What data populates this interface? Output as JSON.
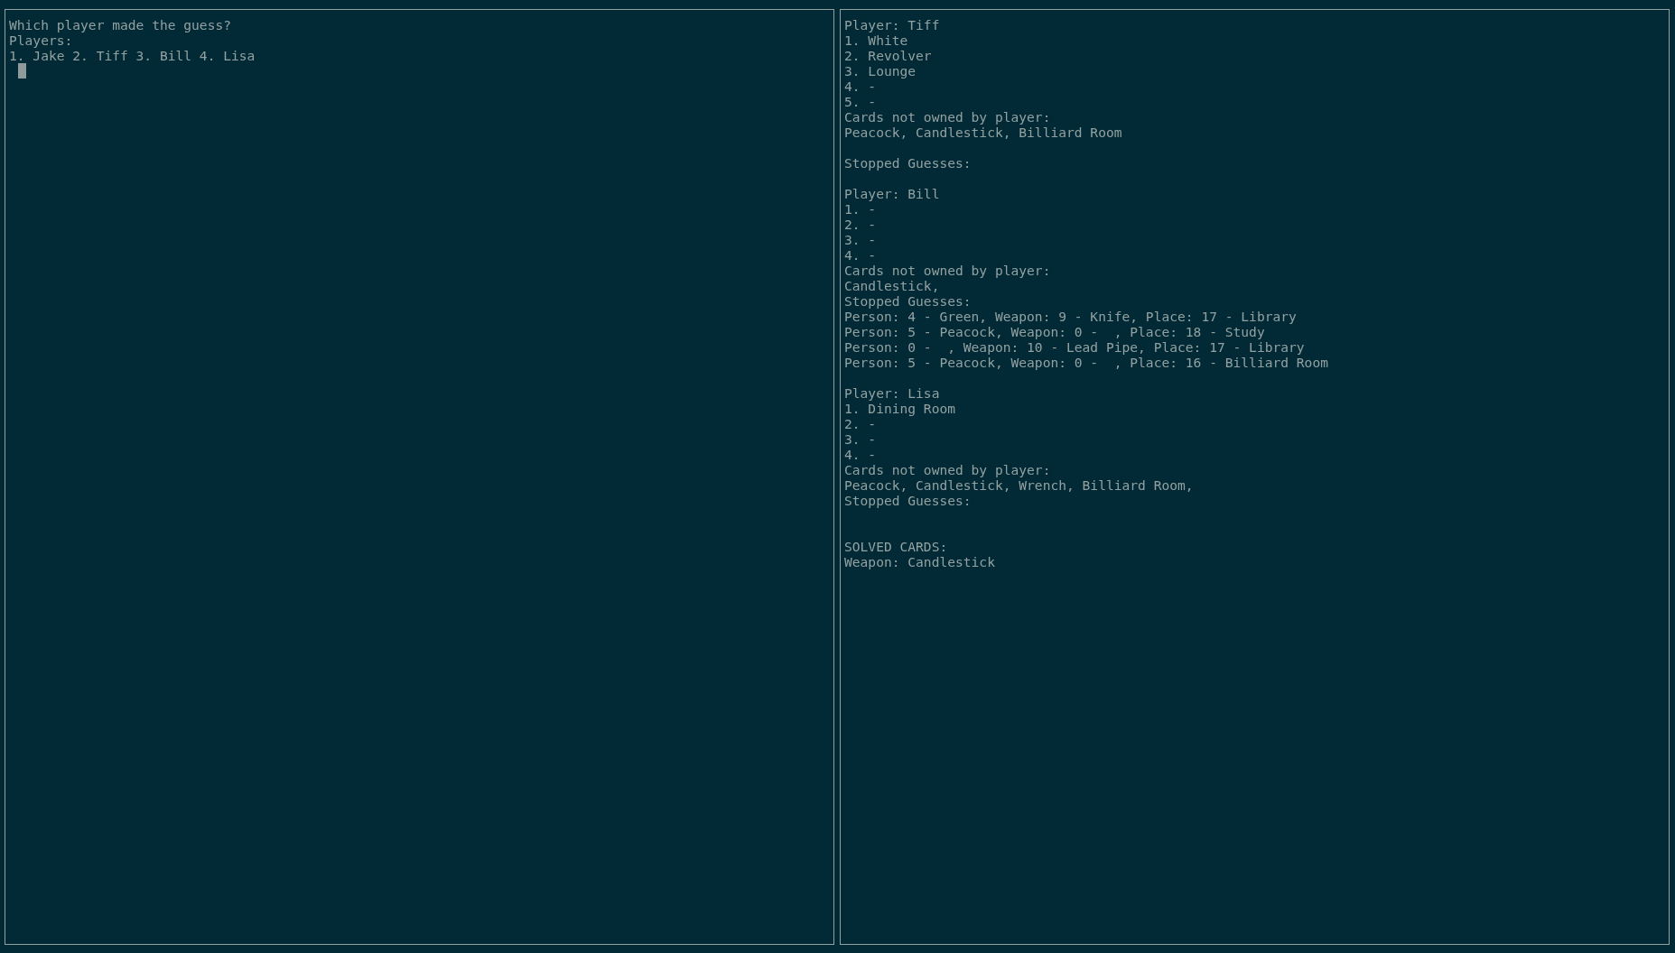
{
  "panes": [
    {
      "lines": [
        {
          "kind": "text",
          "text": "Which player made the guess?"
        },
        {
          "kind": "text",
          "text": "Players:"
        },
        {
          "kind": "text",
          "text": "1. Jake 2. Tiff 3. Bill 4. Lisa"
        },
        {
          "kind": "cursor"
        }
      ]
    },
    {
      "lines": [
        {
          "kind": "text",
          "text": "Player: Tiff"
        },
        {
          "kind": "text",
          "text": "1. White"
        },
        {
          "kind": "text",
          "text": "2. Revolver"
        },
        {
          "kind": "text",
          "text": "3. Lounge"
        },
        {
          "kind": "text",
          "text": "4. -"
        },
        {
          "kind": "text",
          "text": "5. -"
        },
        {
          "kind": "text",
          "text": "Cards not owned by player:"
        },
        {
          "kind": "text",
          "text": "Peacock, Candlestick, Billiard Room"
        },
        {
          "kind": "blank"
        },
        {
          "kind": "text",
          "text": "Stopped Guesses:"
        },
        {
          "kind": "blank"
        },
        {
          "kind": "text",
          "text": "Player: Bill"
        },
        {
          "kind": "text",
          "text": "1. -"
        },
        {
          "kind": "text",
          "text": "2. -"
        },
        {
          "kind": "text",
          "text": "3. -"
        },
        {
          "kind": "text",
          "text": "4. -"
        },
        {
          "kind": "text",
          "text": "Cards not owned by player:"
        },
        {
          "kind": "text",
          "text": "Candlestick,"
        },
        {
          "kind": "text",
          "text": "Stopped Guesses:"
        },
        {
          "kind": "text",
          "text": "Person: 4 - Green, Weapon: 9 - Knife, Place: 17 - Library"
        },
        {
          "kind": "text",
          "text": "Person: 5 - Peacock, Weapon: 0 -  , Place: 18 - Study"
        },
        {
          "kind": "text",
          "text": "Person: 0 -  , Weapon: 10 - Lead Pipe, Place: 17 - Library"
        },
        {
          "kind": "text",
          "text": "Person: 5 - Peacock, Weapon: 0 -  , Place: 16 - Billiard Room"
        },
        {
          "kind": "blank"
        },
        {
          "kind": "text",
          "text": "Player: Lisa"
        },
        {
          "kind": "text",
          "text": "1. Dining Room"
        },
        {
          "kind": "text",
          "text": "2. -"
        },
        {
          "kind": "text",
          "text": "3. -"
        },
        {
          "kind": "text",
          "text": "4. -"
        },
        {
          "kind": "text",
          "text": "Cards not owned by player:"
        },
        {
          "kind": "text",
          "text": "Peacock, Candlestick, Wrench, Billiard Room,"
        },
        {
          "kind": "text",
          "text": "Stopped Guesses:"
        },
        {
          "kind": "blank"
        },
        {
          "kind": "blank"
        },
        {
          "kind": "text",
          "text": "SOLVED CARDS:"
        },
        {
          "kind": "text",
          "text": "Weapon: Candlestick"
        }
      ]
    }
  ]
}
